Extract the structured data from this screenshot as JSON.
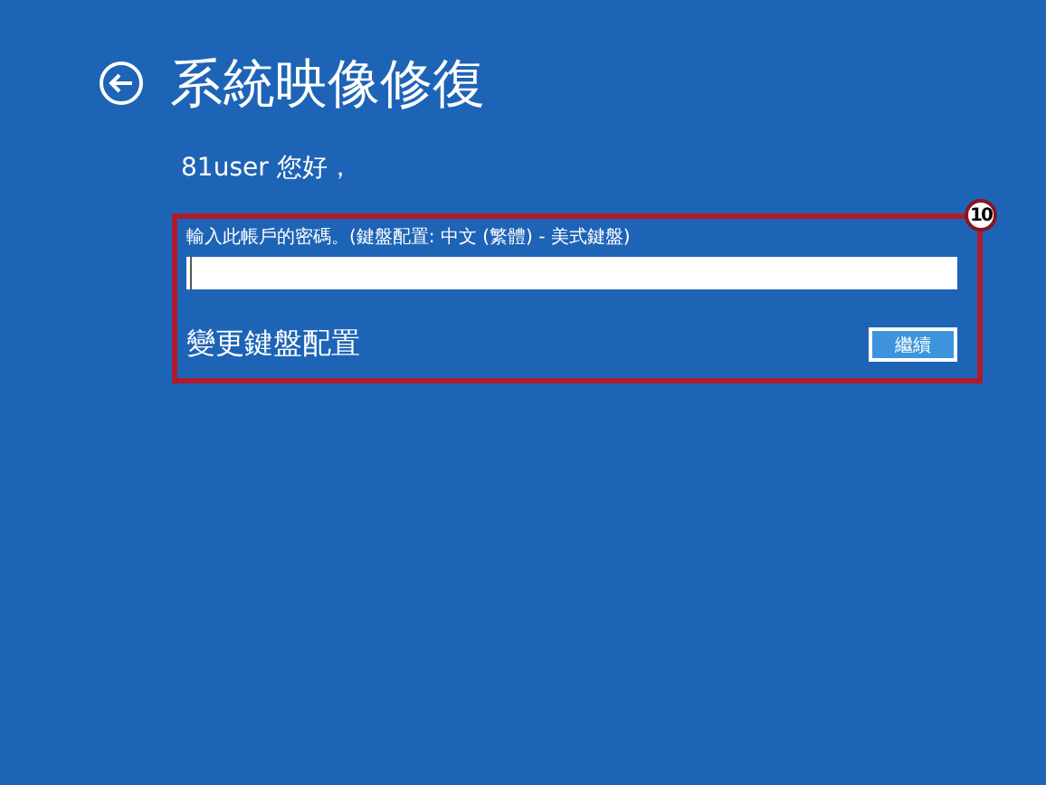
{
  "header": {
    "title": "系統映像修復"
  },
  "greeting": "81user 您好，",
  "form": {
    "label": "輸入此帳戶的密碼。(鍵盤配置: 中文 (繁體) - 美式鍵盤)",
    "password": {
      "focused": true
    },
    "link": "變更鍵盤配置",
    "button": "繼續"
  },
  "annotation": {
    "badge": "10"
  }
}
